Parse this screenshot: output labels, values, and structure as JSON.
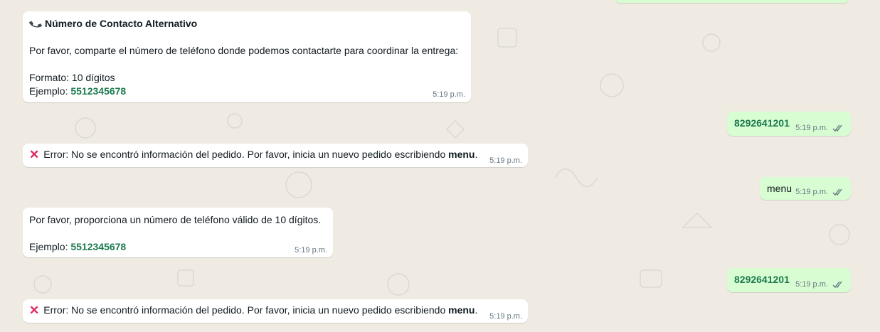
{
  "chat": {
    "messages": [
      {
        "direction": "incoming",
        "icon": "phone-icon",
        "title": "Número de Contacto Alternativo",
        "body": "Por favor, comparte el número de teléfono donde podemos contactarte para coordinar la entrega:",
        "format_line": "Formato: 10 dígitos",
        "example_label": "Ejemplo: ",
        "example_value": "5512345678",
        "time": "5:19 p.m."
      },
      {
        "direction": "outgoing",
        "text": "8292641201",
        "time": "5:19 p.m.",
        "status": "read"
      },
      {
        "direction": "incoming",
        "icon": "cross-mark-icon",
        "text_prefix": "Error: No se encontró información del pedido. Por favor, inicia un nuevo pedido escribiendo ",
        "text_bold": "menu",
        "text_suffix": ".",
        "time": "5:19 p.m."
      },
      {
        "direction": "outgoing",
        "text": "menu",
        "time": "5:19 p.m.",
        "status": "read"
      },
      {
        "direction": "incoming",
        "body": "Por favor, proporciona un número de teléfono válido de 10 dígitos.",
        "example_label": "Ejemplo: ",
        "example_value": "5512345678",
        "time": "5:19 p.m."
      },
      {
        "direction": "outgoing",
        "text": "8292641201",
        "time": "5:19 p.m.",
        "status": "read"
      },
      {
        "direction": "incoming",
        "icon": "cross-mark-icon",
        "text_prefix": "Error: No se encontró información del pedido. Por favor, inicia un nuevo pedido escribiendo ",
        "text_bold": "menu",
        "text_suffix": ".",
        "time": "5:19 p.m."
      }
    ]
  },
  "colors": {
    "background": "#efeae2",
    "incoming_bubble": "#ffffff",
    "outgoing_bubble": "#d9fdd3",
    "link_green": "#1b7a4e",
    "tick_color": "#667781",
    "error_red": "#e0245e"
  }
}
